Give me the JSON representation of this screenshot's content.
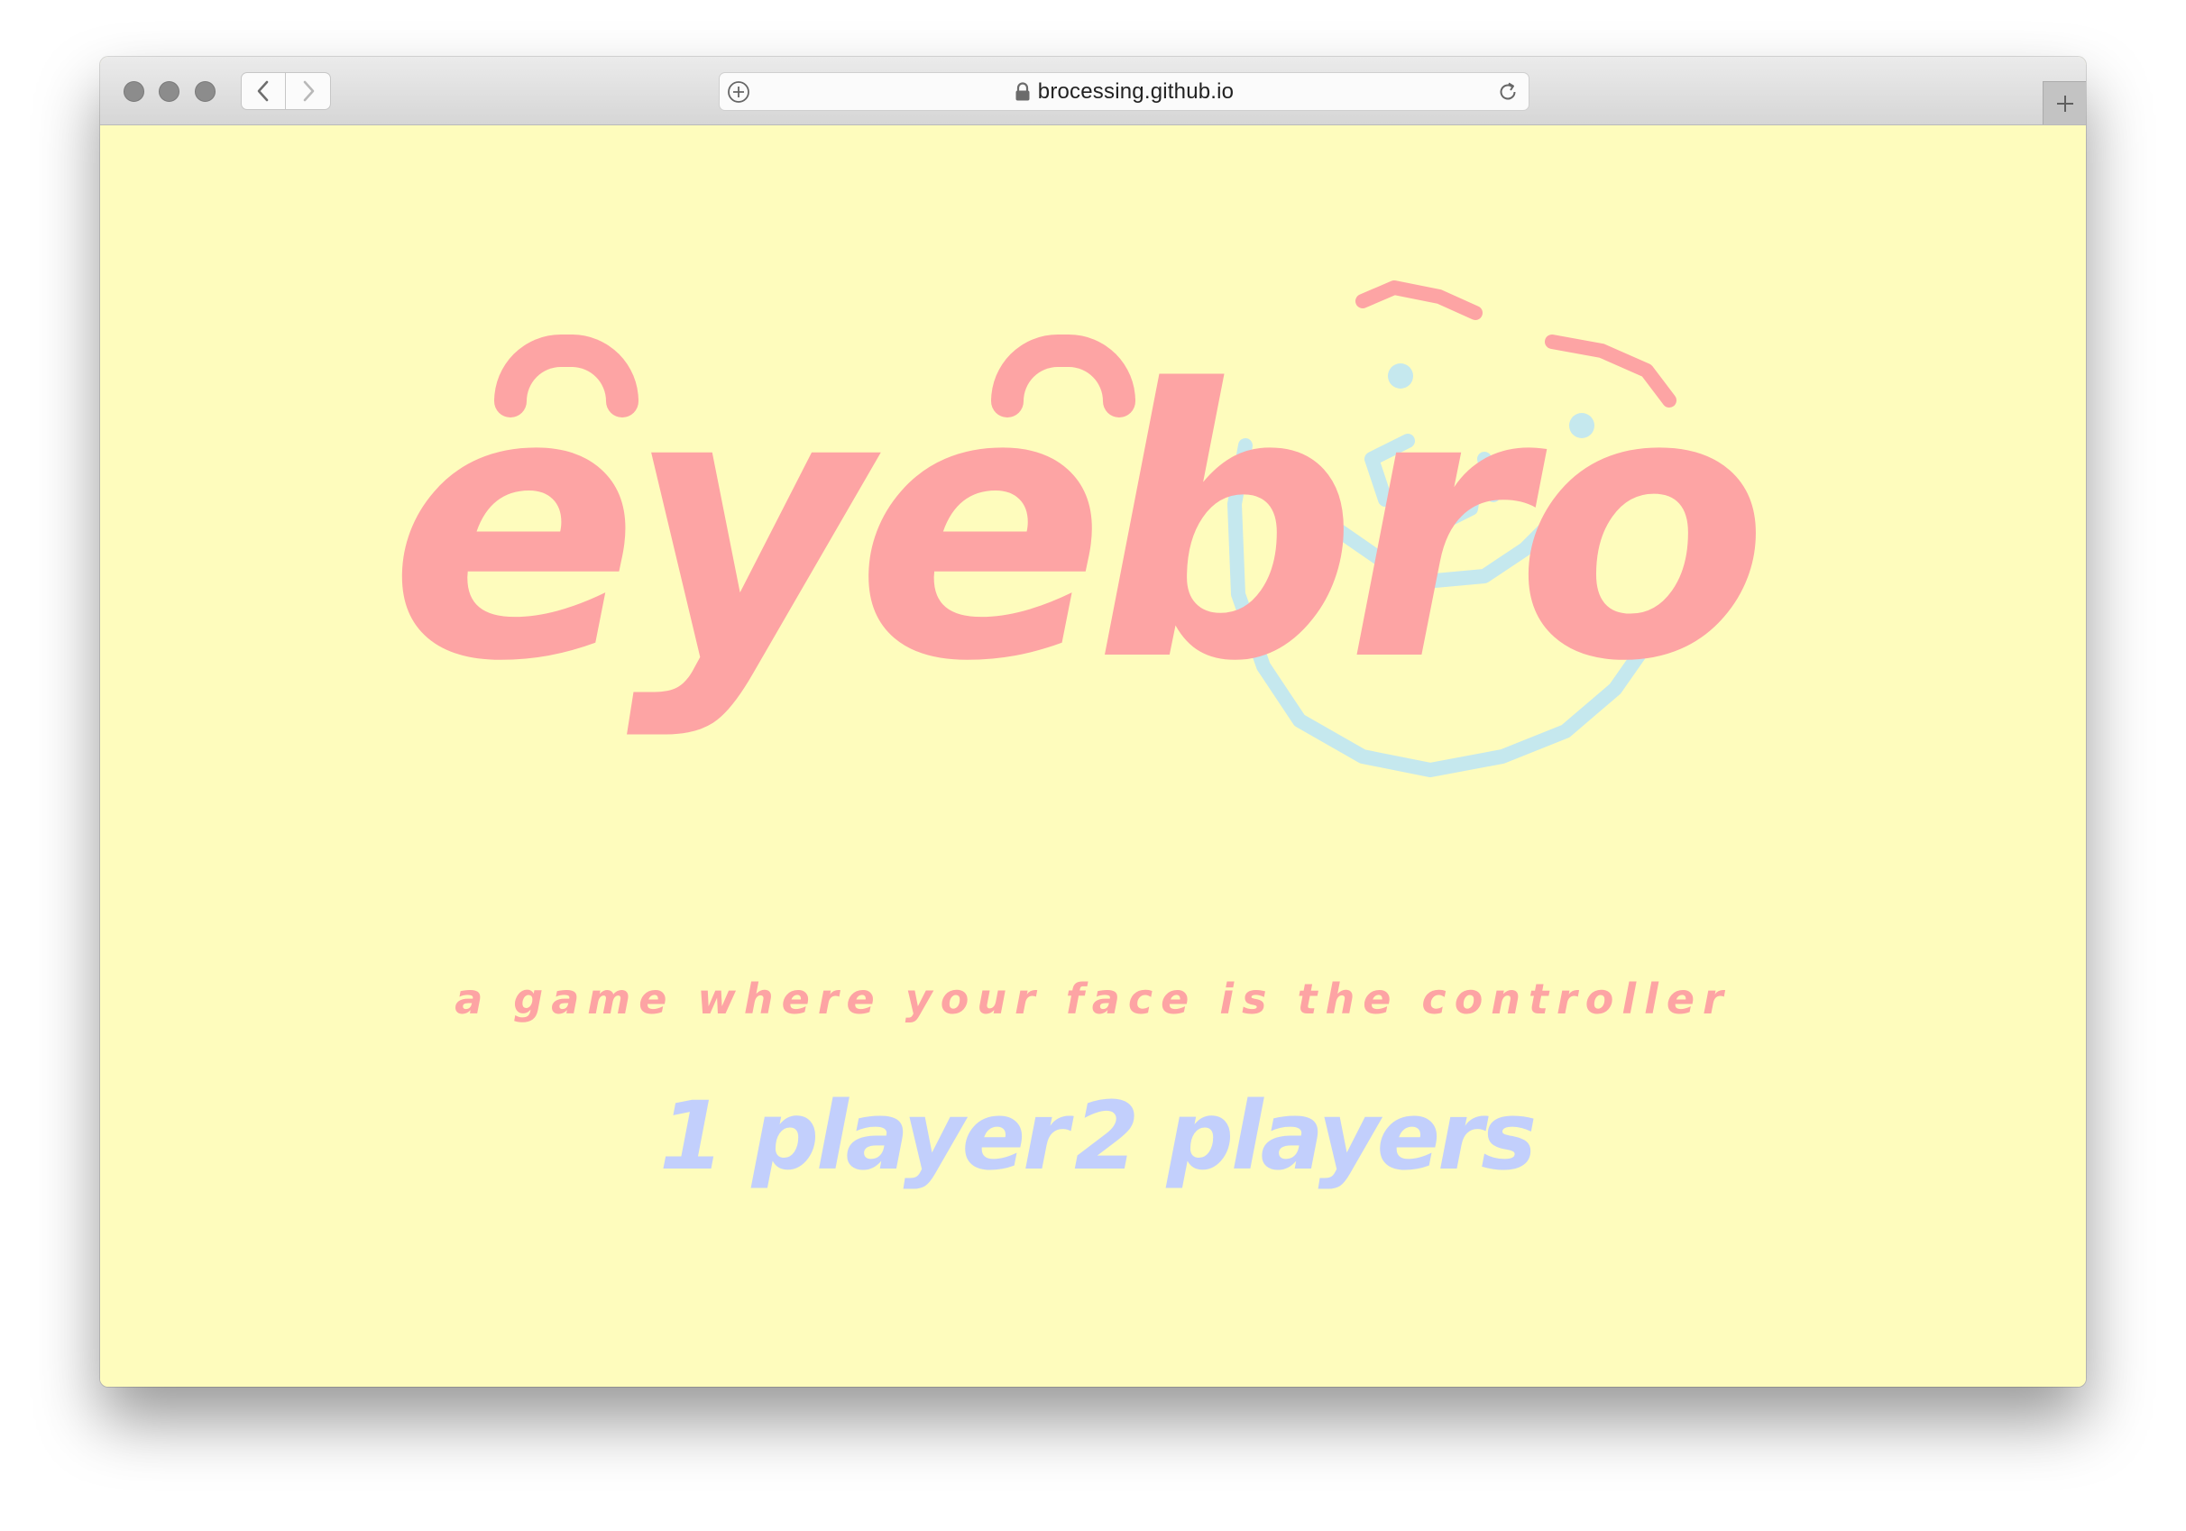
{
  "browser": {
    "url": "brocessing.github.io",
    "icons": {
      "close": "traffic-light-close",
      "minimize": "traffic-light-minimize",
      "maximize": "traffic-light-maximize",
      "back": "chevron-left-icon",
      "forward": "chevron-right-icon",
      "add": "plus-circle-icon",
      "lock": "lock-icon",
      "reload": "reload-icon",
      "new_tab": "plus-icon"
    }
  },
  "game": {
    "title": "eyebro",
    "tagline": "a game where your face is the controller",
    "menu": {
      "one_player": "1 player",
      "two_players": "2 players"
    }
  },
  "colors": {
    "background": "#fefcbd",
    "title_pink": "#fda4a4",
    "menu_blue": "#c2cffc",
    "face_blue": "#c5e8ee"
  }
}
